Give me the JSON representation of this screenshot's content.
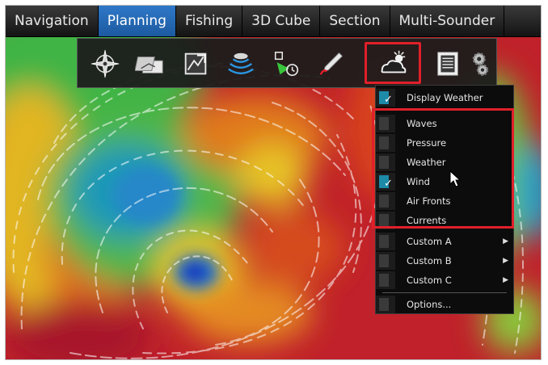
{
  "tabs": [
    {
      "label": "Navigation",
      "active": false
    },
    {
      "label": "Planning",
      "active": true
    },
    {
      "label": "Fishing",
      "active": false
    },
    {
      "label": "3D Cube",
      "active": false
    },
    {
      "label": "Section",
      "active": false
    },
    {
      "label": "Multi-Sounder",
      "active": false
    }
  ],
  "toolbar": {
    "tools": [
      "compass-rose-icon",
      "route-sheets-icon",
      "chart-frame-icon",
      "satellite-dish-icon",
      "target-timer-icon",
      "pen-icon",
      "weather-icon",
      "table-panel-icon",
      "gears-icon"
    ],
    "selected": "weather-icon"
  },
  "menu": {
    "display_weather": {
      "label": "Display Weather",
      "checked": true
    },
    "layers": [
      {
        "label": "Waves",
        "checked": false
      },
      {
        "label": "Pressure",
        "checked": false
      },
      {
        "label": "Weather",
        "checked": false
      },
      {
        "label": "Wind",
        "checked": true
      },
      {
        "label": "Air Fronts",
        "checked": false
      },
      {
        "label": "Currents",
        "checked": false
      }
    ],
    "custom": [
      {
        "label": "Custom A"
      },
      {
        "label": "Custom B"
      },
      {
        "label": "Custom C"
      }
    ],
    "options": {
      "label": "Options..."
    },
    "check_glyph": "✓",
    "submenu_glyph": "▶"
  },
  "colors": {
    "highlight": "#e0202a",
    "active_tab": "#2f78c8",
    "check_gutter": "#1d8aa8"
  }
}
